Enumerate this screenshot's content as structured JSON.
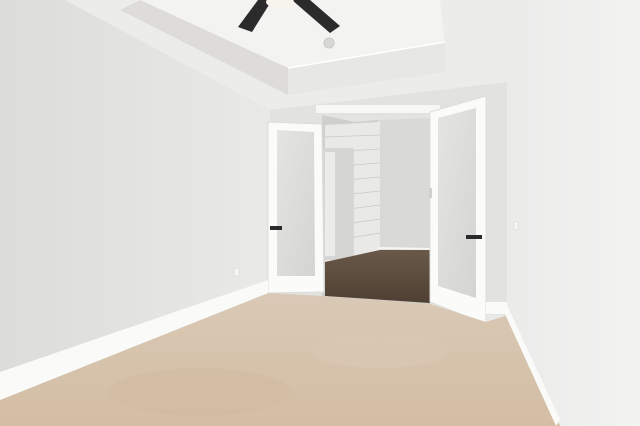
{
  "scene": {
    "subject": "empty bedroom",
    "colors": {
      "wall": "#e6e6e4",
      "ceiling": "#f1f1ef",
      "carpet": "#d8c6b0",
      "hardwood": "#5b4a3c",
      "trim": "#ffffff",
      "door_glass": "#dcdcda",
      "fan": "#2b2b2b"
    },
    "elements": [
      "tray-ceiling",
      "ceiling-fan",
      "smoke-detector",
      "left-wall",
      "right-wall",
      "french-doors",
      "frosted-glass-panels",
      "door-handles",
      "hallway",
      "shiplap-wall",
      "hardwood-floor",
      "carpet",
      "baseboards",
      "outlet"
    ]
  }
}
